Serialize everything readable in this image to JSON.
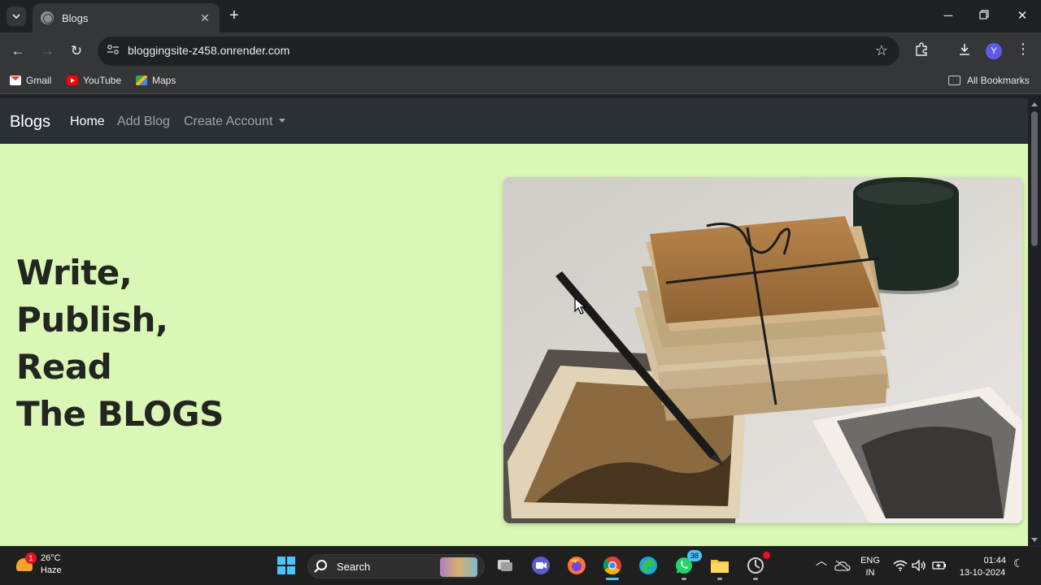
{
  "browser": {
    "tab_title": "Blogs",
    "url": "bloggingsite-z458.onrender.com",
    "profile_initial": "Y",
    "bookmarks": [
      {
        "label": "Gmail",
        "icon": "gmail-icon"
      },
      {
        "label": "YouTube",
        "icon": "youtube-icon"
      },
      {
        "label": "Maps",
        "icon": "maps-icon"
      }
    ],
    "all_bookmarks_label": "All Bookmarks"
  },
  "site": {
    "brand": "Blogs",
    "nav": {
      "home": "Home",
      "add_blog": "Add Blog",
      "create_account": "Create Account"
    },
    "hero": {
      "lines": [
        "Write,",
        "Publish,",
        "Read",
        "The BLOGS"
      ],
      "image_alt_icon": "hero-photo"
    },
    "colors": {
      "navbar_bg": "#2b3035",
      "page_bg": "#daf7b6",
      "heading": "#222520"
    }
  },
  "taskbar": {
    "weather_temp": "26°C",
    "weather_desc": "Haze",
    "weather_badge": "1",
    "search_label": "Search",
    "whatsapp_badge": "38",
    "lang_line1": "ENG",
    "lang_line2": "IN",
    "time": "01:44",
    "date": "13-10-2024"
  }
}
